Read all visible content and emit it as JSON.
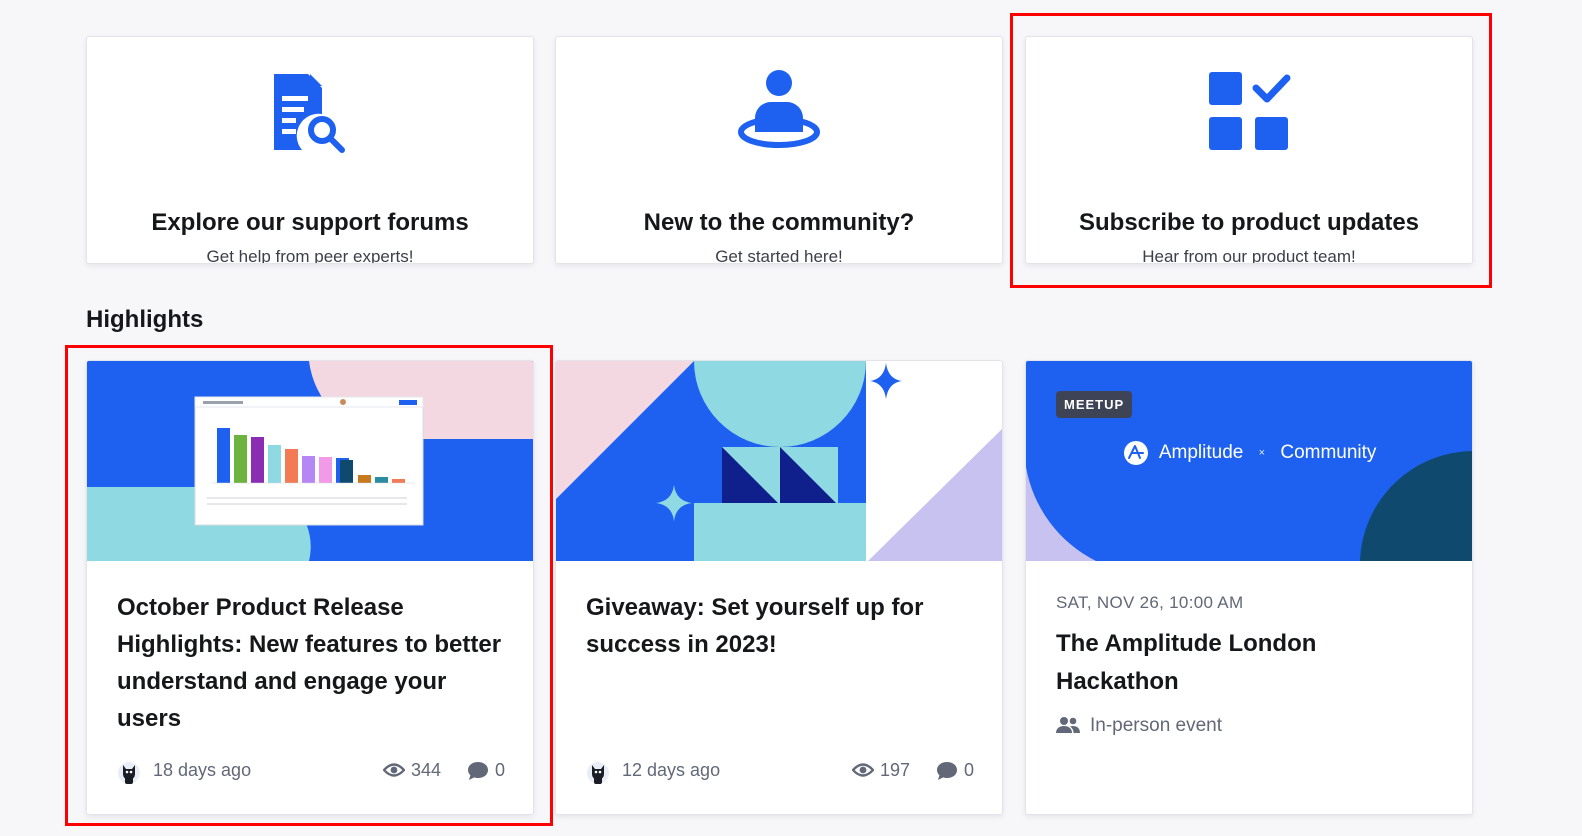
{
  "top_cards": [
    {
      "title": "Explore our support forums",
      "subtitle": "Get help from peer experts!",
      "icon": "document-search-icon"
    },
    {
      "title": "New to the community?",
      "subtitle": "Get started here!",
      "icon": "person-platform-icon"
    },
    {
      "title": "Subscribe to product updates",
      "subtitle": "Hear from our product team!",
      "icon": "checklist-grid-icon"
    }
  ],
  "highlights": {
    "heading": "Highlights",
    "cards": [
      {
        "title": "October Product Release Highlights: New features to better understand and engage your users",
        "time_ago": "18 days ago",
        "views": "344",
        "comments": "0"
      },
      {
        "title": "Giveaway: Set yourself up for success in 2023!",
        "time_ago": "12 days ago",
        "views": "197",
        "comments": "0"
      }
    ],
    "event": {
      "badge": "MEETUP",
      "brand_left": "Amplitude",
      "brand_separator": "×",
      "brand_right": "Community",
      "date": "SAT, NOV 26, 10:00 AM",
      "title": "The Amplitude London Hackathon",
      "type": "In-person event"
    }
  },
  "colors": {
    "brand_blue": "#1e61f0",
    "light_cyan": "#8fd9e2",
    "pink": "#f3d8e1",
    "lavender": "#c8c2f0",
    "navy": "#0f1f8c",
    "dark_teal": "#0f4a6e",
    "highlight_red": "#ff0000"
  }
}
